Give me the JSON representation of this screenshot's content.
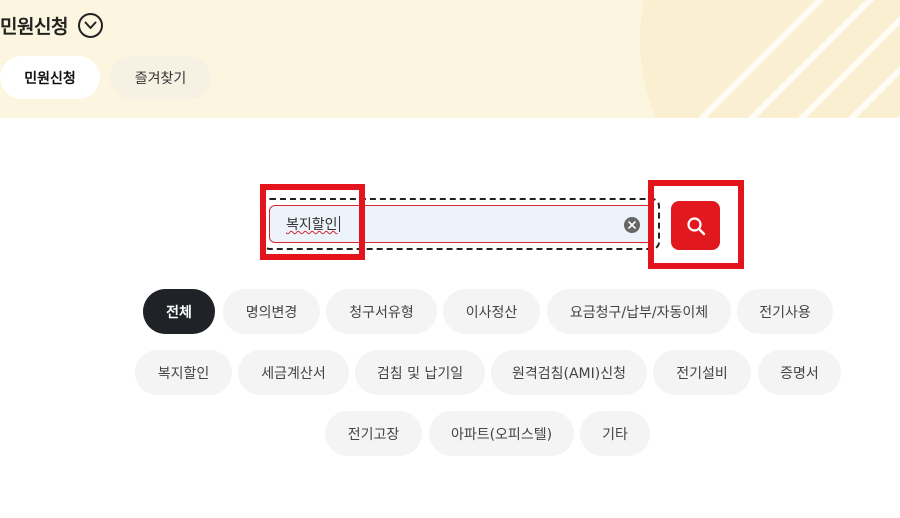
{
  "header": {
    "title": "민원신청",
    "tabs": [
      {
        "label": "민원신청",
        "active": true
      },
      {
        "label": "즐겨찾기",
        "active": false
      }
    ]
  },
  "search": {
    "value": "복지할인",
    "clear_icon": "close-circle-icon",
    "button_icon": "search-icon"
  },
  "categories": [
    "전체",
    "명의변경",
    "청구서유형",
    "이사정산",
    "요금청구/납부/자동이체",
    "전기사용",
    "복지할인",
    "세금계산서",
    "검침 및 납기일",
    "원격검침(AMI)신청",
    "전기설비",
    "증명서",
    "전기고장",
    "아파트(오피스텔)",
    "기타"
  ],
  "selected_category": "전체",
  "colors": {
    "header_bg": "#fcf5df",
    "accent": "#e1191f",
    "highlight_box": "#e3141c",
    "chip_active": "#1f2227",
    "chip_bg": "#f4f4f5"
  }
}
